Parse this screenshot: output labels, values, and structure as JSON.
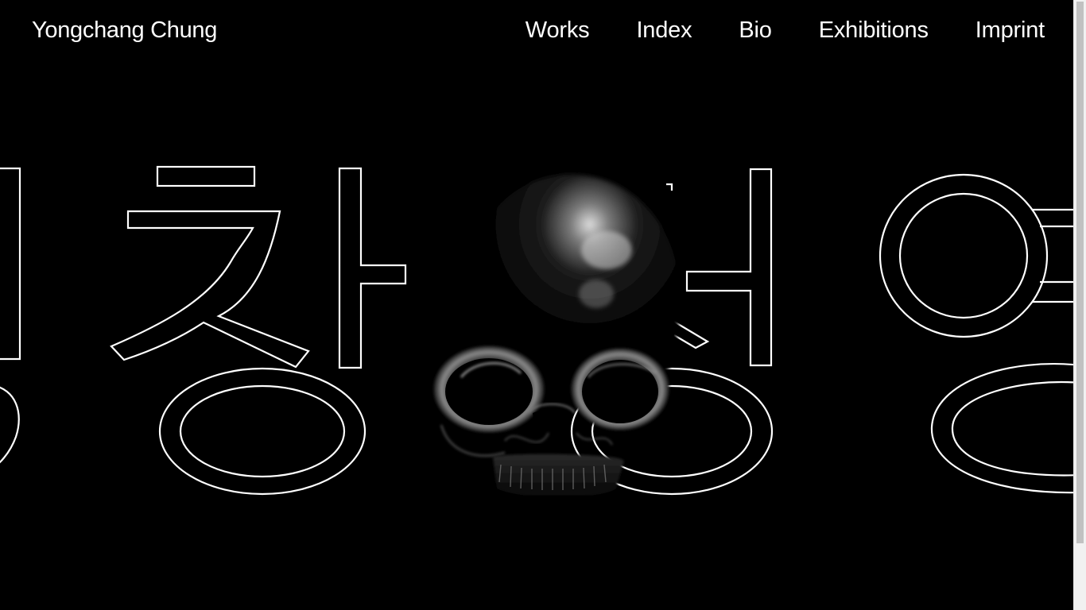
{
  "header": {
    "site_title": "Yongchang Chung",
    "nav": [
      {
        "label": "Works"
      },
      {
        "label": "Index"
      },
      {
        "label": "Bio"
      },
      {
        "label": "Exhibitions"
      },
      {
        "label": "Imprint"
      }
    ]
  },
  "hero": {
    "outline_text": "정창정영",
    "graphic": "skull-3d-render"
  },
  "colors": {
    "background": "#000000",
    "text": "#ffffff",
    "outline": "#ffffff"
  }
}
